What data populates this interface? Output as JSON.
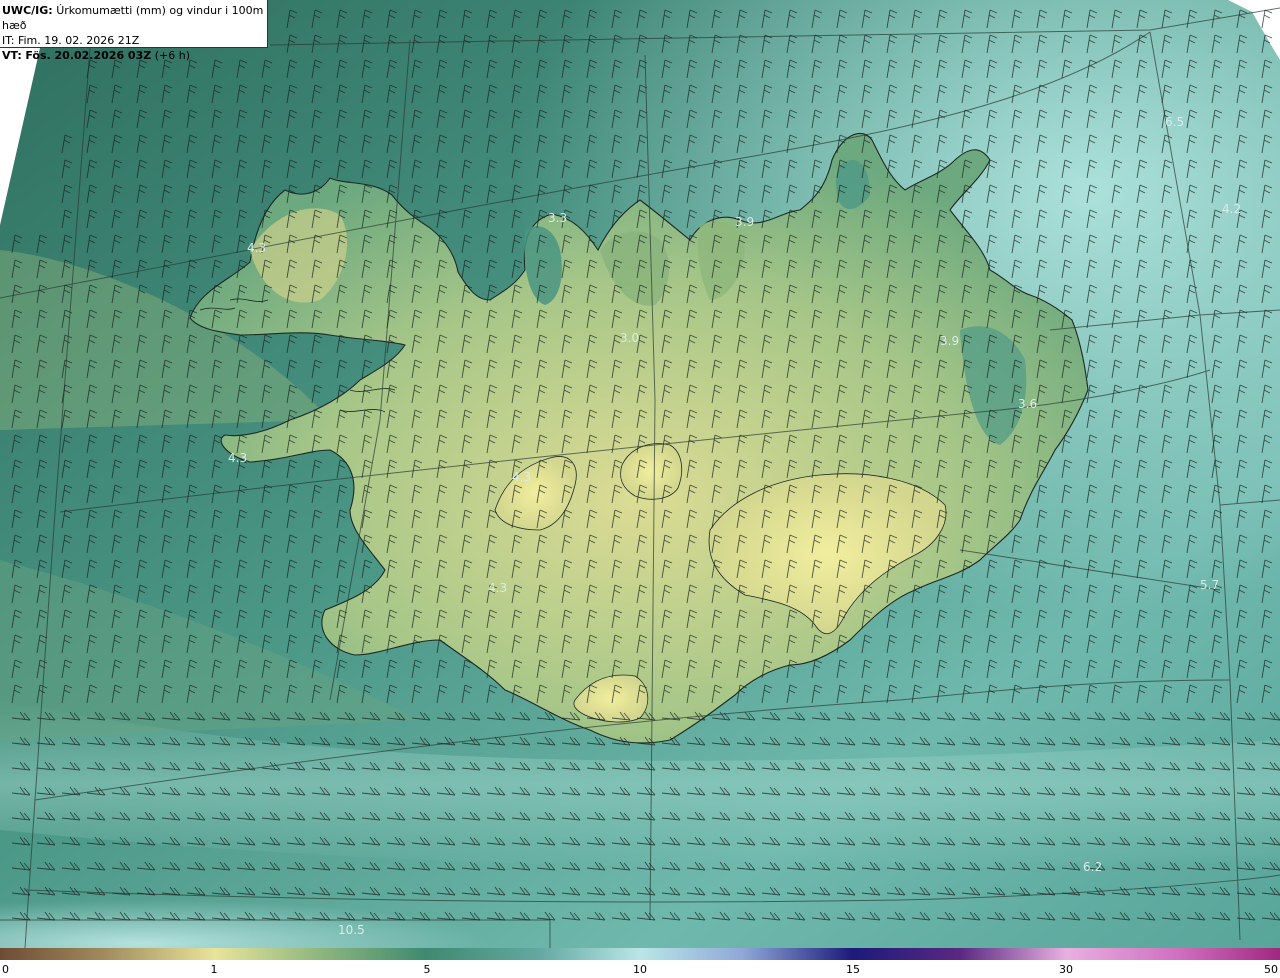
{
  "header": {
    "product": "UWC/IG:",
    "title": "Úrkomumætti (mm) og vindur i 100m hæð",
    "init_time": "IT: Fim. 19. 02. 2026 21Z",
    "valid_prefix": "VT:",
    "valid_time": "Fös. 20.02.2026 03Z",
    "lead": "(+6 h)"
  },
  "values": [
    "6.5",
    "4.3",
    "3.3",
    "3.9",
    "3.0",
    "3.9",
    "3.6",
    "4.2",
    "4.3",
    "5.7",
    "6.2",
    "10.5",
    "4.3",
    "4.3"
  ],
  "colorbar": {
    "ticks": [
      "0",
      "1",
      "5",
      "10",
      "15",
      "30",
      "50"
    ],
    "colors": [
      "#7a5c3c",
      "#c9b274",
      "#e8e49a",
      "#5f9f86",
      "#2f7a70",
      "#8fd6d3",
      "#cfeef0",
      "#3a48a8",
      "#1a1670",
      "#6a2a8a",
      "#d070c0",
      "#f7b6e2",
      "#b0308a"
    ]
  },
  "map_colors": {
    "sea_dark": "#2f7566",
    "sea_mid": "#4f9a8a",
    "sea_light": "#9fd9d6",
    "land_low": "#8ab882",
    "land_high": "#e6e49a"
  }
}
